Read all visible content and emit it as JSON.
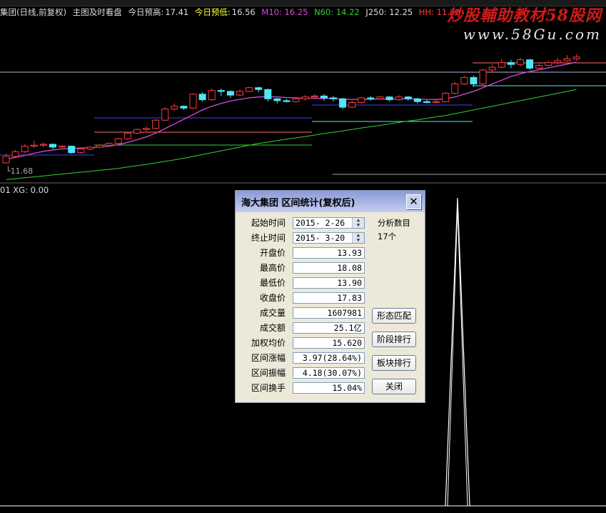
{
  "header": {
    "stock_title": "集团(日线,前复权)",
    "chart_mode": "主图及时看盘",
    "forecast_high_label": "今日预高:",
    "forecast_high": "17.41",
    "forecast_low_label": "今日预低:",
    "forecast_low": "16.56",
    "m10": "M10: 16.25",
    "n60": "N60: 14.22",
    "j250": "J250: 12.25",
    "hh": "HH: 11.38"
  },
  "watermark": {
    "line1": "炒股輔助教材58股网",
    "line2": "www.58Gu.com"
  },
  "price_low_label": "11.68",
  "indicator_label": "01  XG: 0.00",
  "colors": {
    "up": "#ff3a3a",
    "down": "#4fe7f5",
    "ma_pink": "#d64cd6",
    "ma_green": "#35d035",
    "blue_line": "#4040ff",
    "white": "#ffffff"
  },
  "dialog": {
    "title": "海大集团  区间统计(复权后)",
    "close_symbol": "✕",
    "start_label": "起始时间",
    "start_value": "2015- 2-26",
    "end_label": "终止时间",
    "end_value": "2015- 3-20",
    "analysis_label": "分析数目",
    "analysis_value": "17个",
    "rows": [
      {
        "label": "开盘价",
        "value": "13.93"
      },
      {
        "label": "最高价",
        "value": "18.08"
      },
      {
        "label": "最低价",
        "value": "13.90"
      },
      {
        "label": "收盘价",
        "value": "17.83"
      },
      {
        "label": "成交量",
        "value": "1607981"
      },
      {
        "label": "成交额",
        "value": "25.1亿"
      },
      {
        "label": "加权均价",
        "value": "15.620"
      },
      {
        "label": "区间涨幅",
        "value": "3.97(28.64%)"
      },
      {
        "label": "区间振幅",
        "value": "4.18(30.07%)"
      },
      {
        "label": "区间换手",
        "value": "15.04%"
      }
    ],
    "buttons": {
      "pattern": "形态匹配",
      "stage_rank": "阶段排行",
      "sector_rank": "板块排行",
      "close": "关闭"
    }
  },
  "chart_data": {
    "type": "candlestick",
    "candles": [
      [
        0.0,
        0.35,
        0.0,
        0.5
      ],
      [
        0.35,
        0.6,
        0.3,
        0.7
      ],
      [
        0.6,
        0.9,
        0.55,
        1.0
      ],
      [
        0.9,
        0.95,
        0.8,
        1.2
      ],
      [
        0.95,
        1.0,
        0.85,
        1.1
      ],
      [
        1.0,
        0.85,
        0.75,
        1.05
      ],
      [
        0.85,
        0.9,
        0.8,
        0.95
      ],
      [
        0.9,
        0.55,
        0.5,
        0.92
      ],
      [
        0.55,
        0.75,
        0.5,
        0.8
      ],
      [
        0.75,
        0.85,
        0.7,
        0.9
      ],
      [
        0.85,
        0.95,
        0.8,
        1.0
      ],
      [
        0.95,
        1.05,
        0.9,
        1.1
      ],
      [
        1.05,
        1.3,
        1.0,
        1.35
      ],
      [
        1.3,
        1.6,
        1.25,
        1.65
      ],
      [
        1.6,
        1.8,
        1.55,
        1.85
      ],
      [
        1.8,
        1.85,
        1.7,
        1.95
      ],
      [
        1.85,
        2.3,
        1.8,
        2.35
      ],
      [
        2.3,
        2.9,
        2.25,
        3.0
      ],
      [
        2.9,
        3.05,
        2.8,
        3.2
      ],
      [
        3.05,
        2.95,
        2.85,
        3.1
      ],
      [
        2.95,
        3.7,
        2.9,
        3.75
      ],
      [
        3.7,
        3.4,
        3.3,
        3.8
      ],
      [
        3.4,
        3.9,
        3.35,
        4.0
      ],
      [
        3.9,
        3.85,
        3.6,
        4.0
      ],
      [
        3.85,
        3.65,
        3.5,
        3.9
      ],
      [
        3.65,
        3.85,
        3.6,
        3.95
      ],
      [
        3.85,
        4.05,
        3.8,
        4.1
      ],
      [
        4.05,
        3.95,
        3.8,
        4.1
      ],
      [
        3.95,
        3.45,
        3.3,
        4.0
      ],
      [
        3.45,
        3.35,
        3.2,
        3.5
      ],
      [
        3.35,
        3.3,
        3.25,
        3.45
      ],
      [
        3.3,
        3.45,
        3.25,
        3.55
      ],
      [
        3.45,
        3.55,
        3.35,
        3.65
      ],
      [
        3.55,
        3.6,
        3.45,
        3.7
      ],
      [
        3.6,
        3.5,
        3.35,
        3.7
      ],
      [
        3.5,
        3.45,
        3.3,
        3.6
      ],
      [
        3.45,
        3.0,
        2.9,
        3.5
      ],
      [
        3.0,
        3.25,
        2.95,
        3.35
      ],
      [
        3.25,
        3.5,
        3.2,
        3.55
      ],
      [
        3.5,
        3.45,
        3.35,
        3.6
      ],
      [
        3.45,
        3.55,
        3.4,
        3.6
      ],
      [
        3.55,
        3.4,
        3.3,
        3.6
      ],
      [
        3.4,
        3.55,
        3.35,
        3.65
      ],
      [
        3.55,
        3.45,
        3.35,
        3.6
      ],
      [
        3.45,
        3.3,
        3.2,
        3.5
      ],
      [
        3.3,
        3.25,
        3.2,
        3.4
      ],
      [
        3.25,
        3.3,
        3.2,
        3.4
      ],
      [
        3.3,
        3.75,
        3.25,
        3.8
      ],
      [
        3.75,
        4.25,
        3.7,
        4.35
      ],
      [
        4.25,
        4.6,
        4.2,
        4.7
      ],
      [
        4.6,
        4.25,
        4.1,
        4.7
      ],
      [
        4.25,
        5.0,
        4.2,
        5.05
      ],
      [
        5.0,
        5.15,
        4.9,
        5.3
      ],
      [
        5.15,
        5.4,
        5.1,
        5.6
      ],
      [
        5.4,
        5.3,
        5.1,
        5.55
      ],
      [
        5.3,
        5.55,
        5.2,
        5.65
      ],
      [
        5.55,
        5.1,
        5.0,
        5.6
      ],
      [
        5.1,
        5.25,
        5.05,
        5.4
      ],
      [
        5.25,
        5.4,
        5.2,
        5.5
      ],
      [
        5.4,
        5.5,
        5.3,
        5.65
      ],
      [
        5.5,
        5.6,
        5.45,
        5.8
      ],
      [
        5.6,
        5.7,
        5.5,
        5.85
      ]
    ],
    "ma_pink": [
      0.2,
      0.3,
      0.4,
      0.52,
      0.62,
      0.7,
      0.75,
      0.78,
      0.8,
      0.82,
      0.85,
      0.9,
      0.98,
      1.1,
      1.25,
      1.4,
      1.6,
      1.85,
      2.1,
      2.35,
      2.6,
      2.85,
      3.05,
      3.2,
      3.33,
      3.42,
      3.5,
      3.55,
      3.56,
      3.55,
      3.52,
      3.5,
      3.48,
      3.48,
      3.47,
      3.46,
      3.43,
      3.42,
      3.42,
      3.43,
      3.44,
      3.44,
      3.45,
      3.45,
      3.44,
      3.42,
      3.41,
      3.45,
      3.55,
      3.7,
      3.85,
      4.05,
      4.25,
      4.45,
      4.65,
      4.8,
      4.92,
      5.02,
      5.12,
      5.22,
      5.32,
      5.42
    ],
    "ma_green": [
      -0.9,
      -0.85,
      -0.8,
      -0.75,
      -0.7,
      -0.65,
      -0.6,
      -0.55,
      -0.5,
      -0.45,
      -0.4,
      -0.35,
      -0.3,
      -0.22,
      -0.15,
      -0.08,
      0.0,
      0.08,
      0.16,
      0.25,
      0.35,
      0.45,
      0.55,
      0.65,
      0.75,
      0.85,
      0.95,
      1.05,
      1.12,
      1.2,
      1.28,
      1.35,
      1.42,
      1.5,
      1.58,
      1.65,
      1.72,
      1.8,
      1.88,
      1.95,
      2.02,
      2.1,
      2.18,
      2.25,
      2.32,
      2.4,
      2.48,
      2.55,
      2.65,
      2.75,
      2.85,
      2.95,
      3.05,
      3.15,
      3.25,
      3.35,
      3.45,
      3.55,
      3.65,
      3.75,
      3.85,
      3.95
    ],
    "indicator_peak": 1.0
  }
}
